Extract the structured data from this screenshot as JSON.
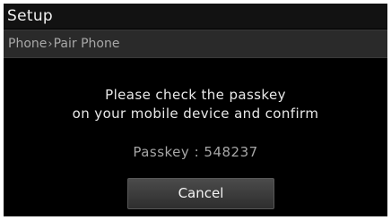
{
  "header": {
    "title": "Setup"
  },
  "breadcrumb": {
    "parent": "Phone",
    "separator": "›",
    "current": "Pair Phone"
  },
  "dialog": {
    "message_line_1": "Please check the passkey",
    "message_line_2": "on your mobile device and confirm",
    "passkey_label": "Passkey",
    "passkey_separator": ":",
    "passkey_value": "548237",
    "cancel_label": "Cancel"
  },
  "colors": {
    "background": "#000000",
    "header_background": "#121212",
    "breadcrumb_background": "#2a2a2a",
    "primary_text": "#f2f2f2",
    "secondary_text": "#a8a8a8",
    "button_background": "#3c3c3c"
  }
}
